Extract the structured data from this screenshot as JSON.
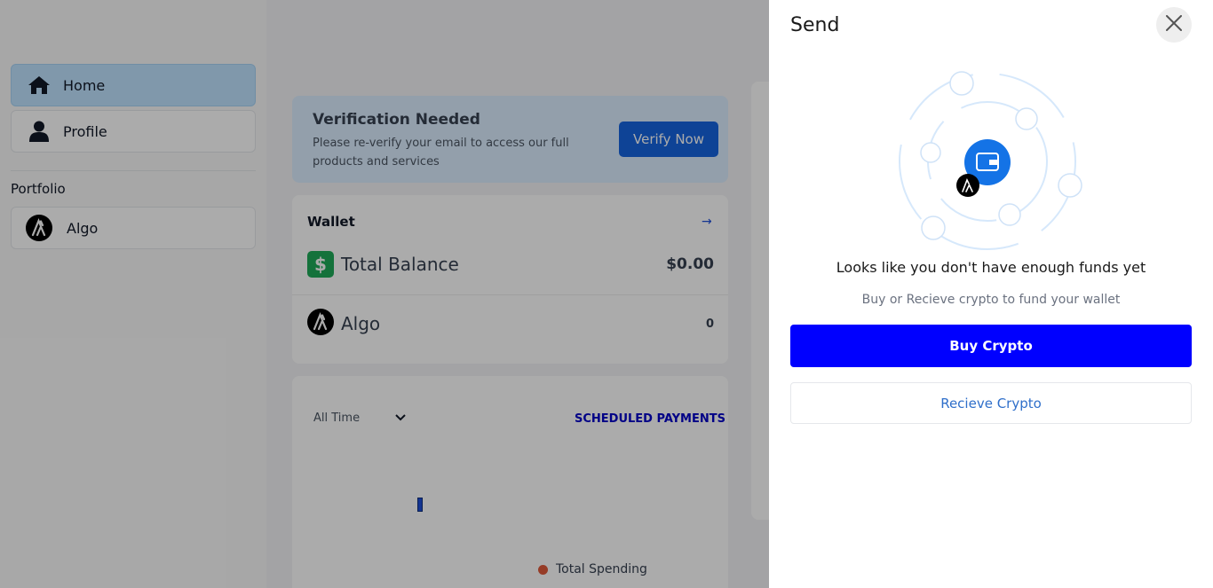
{
  "sidebar": {
    "items": [
      {
        "label": "Home",
        "icon": "home-icon",
        "active": true
      },
      {
        "label": "Profile",
        "icon": "user-icon",
        "active": false
      }
    ],
    "portfolio_heading": "Portfolio",
    "portfolio_items": [
      {
        "label": "Algo",
        "icon": "algorand-icon"
      }
    ]
  },
  "verification": {
    "title": "Verification Needed",
    "message": "Please re-verify your email to access our full products and services",
    "button_label": "Verify Now"
  },
  "wallet": {
    "title": "Wallet",
    "arrow": "→",
    "total_balance_label": "Total Balance",
    "total_balance_value": "$0.00",
    "dollar_symbol": "$",
    "asset_label": "Algo",
    "asset_value": "0"
  },
  "spending": {
    "time_filter": "All Time",
    "scheduled_link": "SCHEDULED PAYMENTS",
    "legend_label": "Total Spending"
  },
  "send_drawer": {
    "title": "Send",
    "empty_title": "Looks like you don't have enough funds yet",
    "empty_subtitle": "Buy or Recieve crypto to fund your wallet",
    "buy_button": "Buy Crypto",
    "receive_button": "Recieve Crypto"
  },
  "colors": {
    "primary_blue": "#0000ff",
    "accent_blue": "#1565e0",
    "success_green": "#1faa59",
    "legend_dot": "#e05a3b"
  }
}
